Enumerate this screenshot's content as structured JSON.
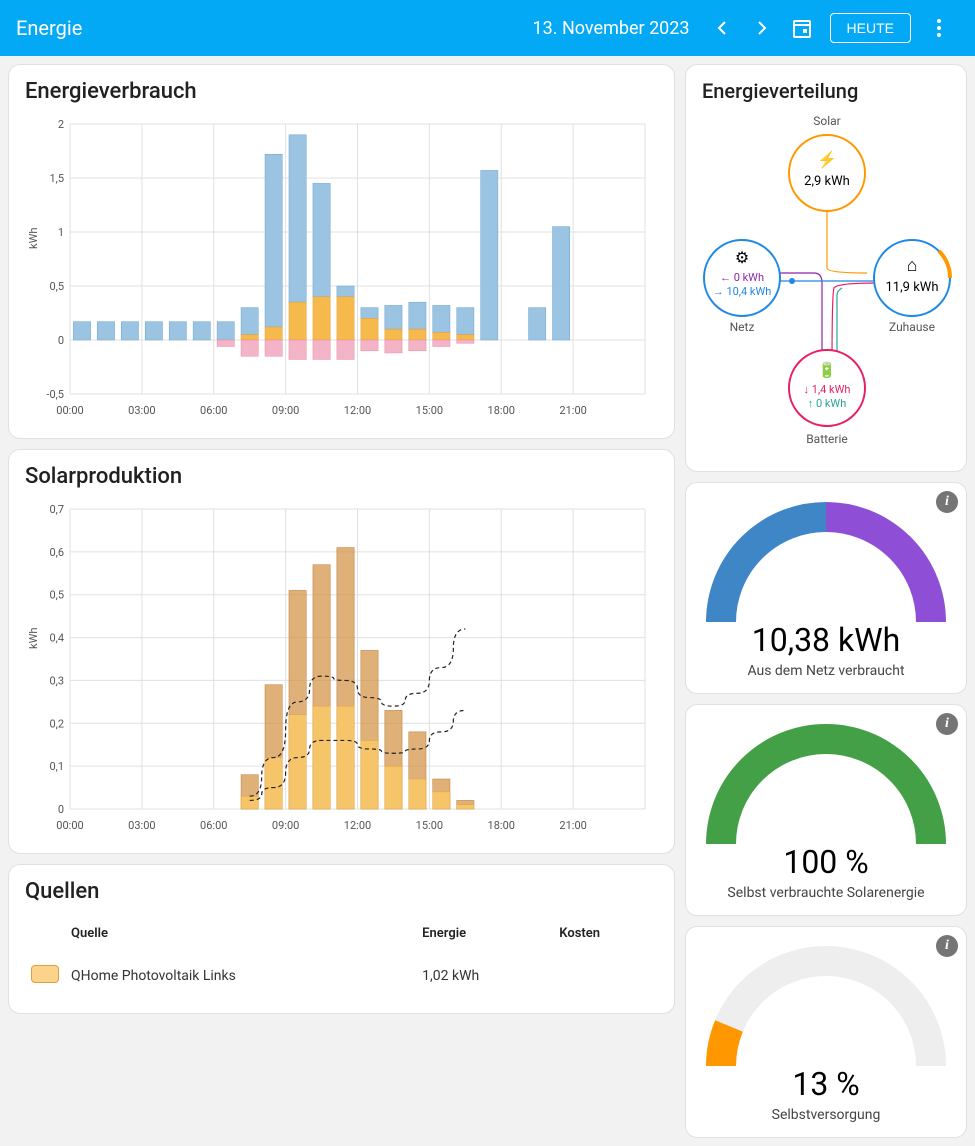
{
  "header": {
    "title": "Energie",
    "date": "13. November 2023",
    "today": "HEUTE"
  },
  "cards": {
    "consumption_title": "Energieverbrauch",
    "production_title": "Solarproduktion",
    "distribution_title": "Energieverteilung",
    "sources_title": "Quellen"
  },
  "distribution": {
    "solar_label": "Solar",
    "solar_value": "2,9 kWh",
    "grid_label": "Netz",
    "grid_in": "← 0 kWh",
    "grid_out": "→ 10,4 kWh",
    "home_label": "Zuhause",
    "home_value": "11,9 kWh",
    "battery_label": "Batterie",
    "battery_down": "↓ 1,4 kWh",
    "battery_up": "↑ 0 kWh"
  },
  "gauge1": {
    "value": "10,38 kWh",
    "label": "Aus dem Netz verbraucht"
  },
  "gauge2": {
    "value": "100 %",
    "label": "Selbst verbrauchte Solarenergie"
  },
  "gauge3": {
    "value": "13 %",
    "label": "Selbstversorgung"
  },
  "sources": {
    "col1": "Quelle",
    "col2": "Energie",
    "col3": "Kosten",
    "row1_name": "QHome Photovoltaik Links",
    "row1_energy": "1,02 kWh"
  },
  "chart_data": [
    {
      "type": "bar",
      "title": "Energieverbrauch",
      "ylabel": "kWh",
      "ylim": [
        -0.5,
        2
      ],
      "x_categories": [
        "00:00",
        "01:00",
        "02:00",
        "03:00",
        "04:00",
        "05:00",
        "06:00",
        "07:00",
        "08:00",
        "09:00",
        "10:00",
        "11:00",
        "12:00",
        "13:00",
        "14:00",
        "15:00",
        "16:00",
        "17:00",
        "18:00",
        "19:00",
        "20:00"
      ],
      "x_ticks_shown": [
        "00:00",
        "03:00",
        "06:00",
        "09:00",
        "12:00",
        "15:00",
        "18:00",
        "21:00"
      ],
      "series": [
        {
          "name": "grid",
          "color": "#9bc3e2",
          "values": [
            0.17,
            0.17,
            0.17,
            0.17,
            0.17,
            0.17,
            0.17,
            0.25,
            1.6,
            1.55,
            1.05,
            0.1,
            0.1,
            0.22,
            0.25,
            0.25,
            0.25,
            1.57,
            0,
            0.3,
            1.05
          ]
        },
        {
          "name": "solar",
          "color": "#f5ba4b",
          "values": [
            0,
            0,
            0,
            0,
            0,
            0,
            0,
            0.05,
            0.12,
            0.35,
            0.4,
            0.4,
            0.2,
            0.1,
            0.1,
            0.07,
            0.05,
            0,
            0,
            0,
            0
          ]
        },
        {
          "name": "battery",
          "color": "#f19fb6",
          "values": [
            0,
            0,
            0,
            0,
            0,
            0,
            -0.06,
            -0.15,
            -0.15,
            -0.18,
            -0.18,
            -0.18,
            -0.1,
            -0.12,
            -0.1,
            -0.06,
            -0.03,
            0,
            0,
            0,
            0
          ]
        }
      ]
    },
    {
      "type": "bar",
      "title": "Solarproduktion",
      "ylabel": "kWh",
      "ylim": [
        0,
        0.7
      ],
      "x_categories": [
        "00:00",
        "01:00",
        "02:00",
        "03:00",
        "04:00",
        "05:00",
        "06:00",
        "07:00",
        "08:00",
        "09:00",
        "10:00",
        "11:00",
        "12:00",
        "13:00",
        "14:00",
        "15:00",
        "16:00"
      ],
      "x_ticks_shown": [
        "00:00",
        "03:00",
        "06:00",
        "09:00",
        "12:00",
        "15:00",
        "18:00",
        "21:00"
      ],
      "series": [
        {
          "name": "prod_total",
          "color": "#d4964a",
          "values": [
            0,
            0,
            0,
            0,
            0,
            0,
            0,
            0.08,
            0.29,
            0.51,
            0.57,
            0.61,
            0.37,
            0.23,
            0.18,
            0.07,
            0.02
          ]
        },
        {
          "name": "prod_inner",
          "color": "#f6c56a",
          "values": [
            0,
            0,
            0,
            0,
            0,
            0,
            0,
            0.03,
            0.12,
            0.22,
            0.24,
            0.24,
            0.16,
            0.1,
            0.07,
            0.04,
            0.01
          ]
        },
        {
          "name": "forecast_line_1",
          "type": "line",
          "values_at_hours": {
            "7": 0.02,
            "8": 0.05,
            "9": 0.12,
            "10": 0.16,
            "11": 0.16,
            "12": 0.14,
            "13": 0.13,
            "14": 0.14,
            "15": 0.18,
            "16": 0.23
          }
        },
        {
          "name": "forecast_line_2",
          "type": "line",
          "values_at_hours": {
            "7": 0.03,
            "8": 0.12,
            "9": 0.25,
            "10": 0.31,
            "11": 0.3,
            "12": 0.26,
            "13": 0.24,
            "14": 0.27,
            "15": 0.33,
            "16": 0.42
          }
        }
      ]
    }
  ]
}
